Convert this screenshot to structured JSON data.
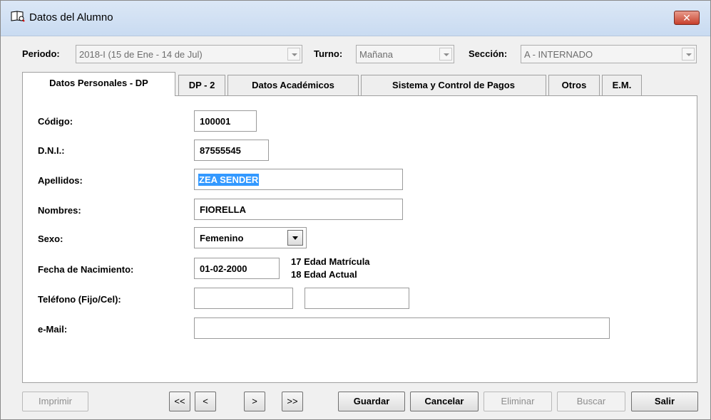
{
  "window": {
    "title": "Datos del Alumno",
    "close_label": "✕"
  },
  "topbar": {
    "periodo_label": "Periodo:",
    "periodo_value": "2018-I (15 de Ene - 14 de Jul)",
    "turno_label": "Turno:",
    "turno_value": "Mañana",
    "seccion_label": "Sección:",
    "seccion_value": "A  - INTERNADO"
  },
  "tabs": [
    {
      "label": "Datos Personales - DP",
      "active": true
    },
    {
      "label": "DP - 2"
    },
    {
      "label": "Datos Académicos"
    },
    {
      "label": "Sistema y Control de Pagos"
    },
    {
      "label": "Otros"
    },
    {
      "label": "E.M."
    }
  ],
  "form": {
    "codigo_label": "Código:",
    "codigo_value": "100001",
    "dni_label": "D.N.I.:",
    "dni_value": "87555545",
    "apellidos_label": "Apellidos:",
    "apellidos_value": "ZEA SENDER",
    "nombres_label": "Nombres:",
    "nombres_value": "FIORELLA",
    "sexo_label": "Sexo:",
    "sexo_value": "Femenino",
    "fecha_label": "Fecha de Nacimiento:",
    "fecha_value": "01-02-2000",
    "edad_matricula": "17 Edad Matrícula",
    "edad_actual": "18 Edad Actual",
    "telefono_label": "Teléfono (Fijo/Cel):",
    "telefono_fijo": "",
    "telefono_cel": "",
    "email_label": "e-Mail:",
    "email_value": ""
  },
  "buttons": {
    "imprimir": "Imprimir",
    "first": "<<",
    "prev": "<",
    "next": ">",
    "last": ">>",
    "guardar": "Guardar",
    "cancelar": "Cancelar",
    "eliminar": "Eliminar",
    "buscar": "Buscar",
    "salir": "Salir"
  },
  "colors": {
    "selection": "#3399ff",
    "close": "#c7402c",
    "titlebar": "#c9dbf1"
  }
}
